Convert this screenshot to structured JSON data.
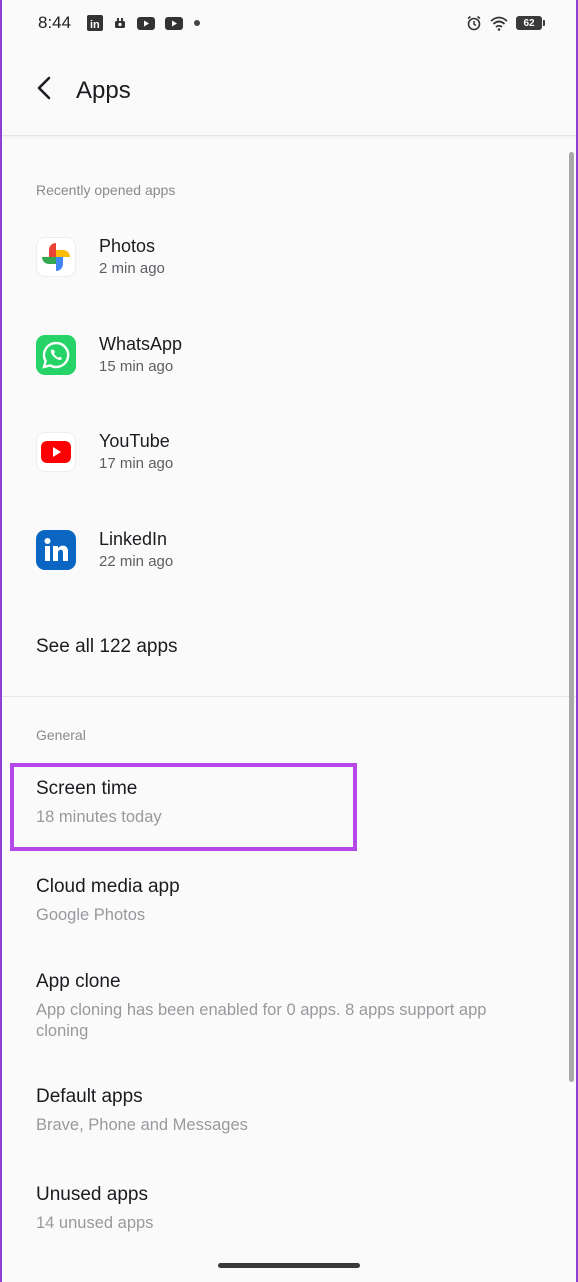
{
  "status_bar": {
    "time": "8:44",
    "battery": "62",
    "left_icons": [
      "linkedin-notification-icon",
      "camera-notification-icon",
      "youtube-notification-icon",
      "youtube-notification-icon",
      "dot-icon"
    ],
    "right_icons": [
      "alarm-icon",
      "wifi-icon",
      "battery-icon"
    ]
  },
  "header": {
    "title": "Apps"
  },
  "recent": {
    "section_title": "Recently opened apps",
    "apps": [
      {
        "name": "Photos",
        "time": "2 min ago",
        "icon": "google-photos-icon"
      },
      {
        "name": "WhatsApp",
        "time": "15 min ago",
        "icon": "whatsapp-icon"
      },
      {
        "name": "YouTube",
        "time": "17 min ago",
        "icon": "youtube-icon"
      },
      {
        "name": "LinkedIn",
        "time": "22 min ago",
        "icon": "linkedin-icon"
      }
    ],
    "see_all": "See all 122 apps"
  },
  "general": {
    "section_title": "General",
    "items": [
      {
        "title": "Screen time",
        "subtitle": "18 minutes today"
      },
      {
        "title": "Cloud media app",
        "subtitle": "Google Photos"
      },
      {
        "title": "App clone",
        "subtitle": "App cloning has been enabled for 0 apps. 8 apps support app cloning"
      },
      {
        "title": "Default apps",
        "subtitle": "Brave, Phone and Messages"
      },
      {
        "title": "Unused apps",
        "subtitle": "14 unused apps"
      }
    ]
  },
  "colors": {
    "highlight": "#b548e8",
    "whatsapp": "#25d366",
    "youtube": "#ff0000",
    "linkedin": "#0a66c2"
  }
}
